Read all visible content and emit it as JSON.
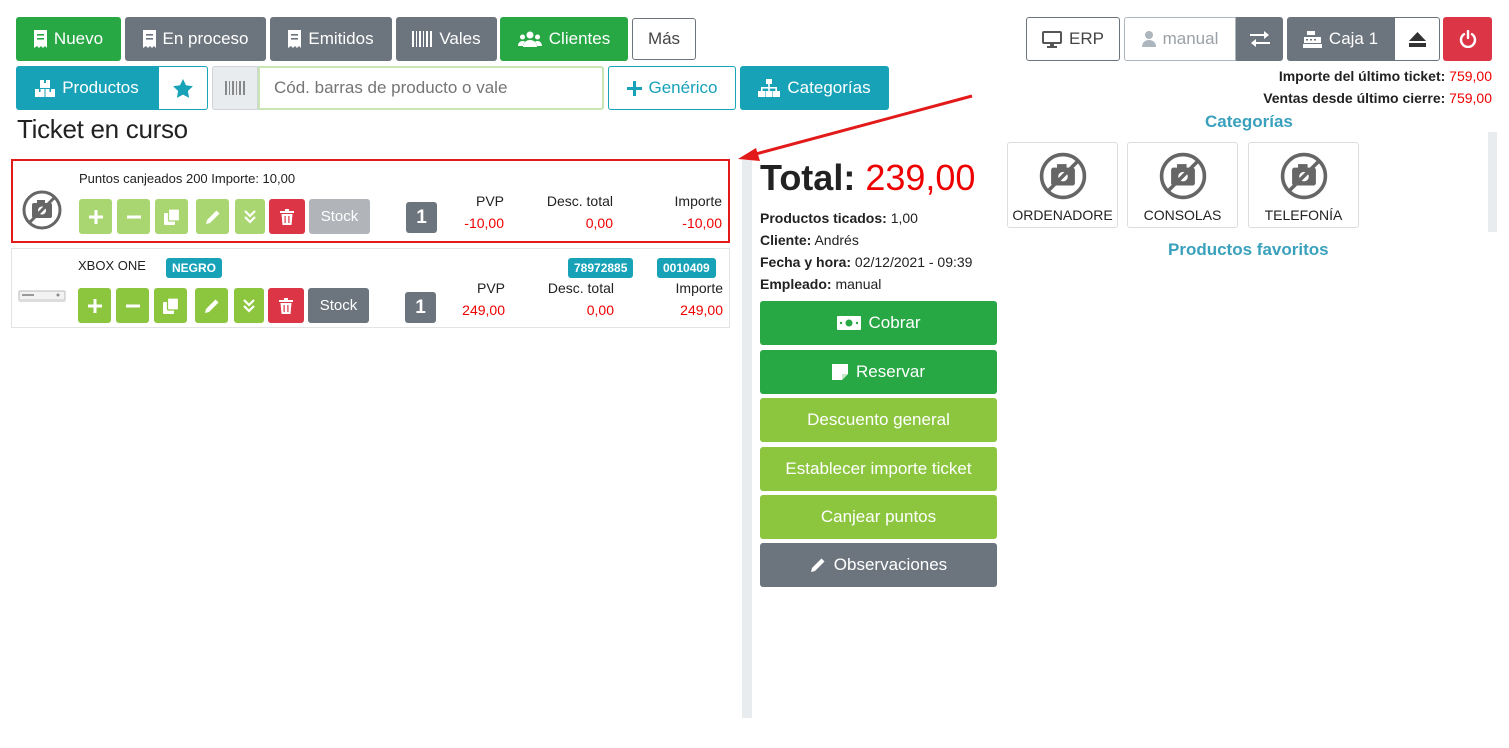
{
  "toolbar": {
    "nuevo": "Nuevo",
    "en_proceso": "En proceso",
    "emitidos": "Emitidos",
    "vales": "Vales",
    "clientes": "Clientes",
    "mas": "Más",
    "erp": "ERP",
    "user": "manual",
    "caja": "Caja 1"
  },
  "subtoolbar": {
    "productos": "Productos",
    "barcode_placeholder": "Cód. barras de producto o vale",
    "generico": "Genérico",
    "categorias": "Categorías"
  },
  "ticket": {
    "title": "Ticket en curso",
    "lines": [
      {
        "name": "Puntos canjeados 200 Importe: 10,00",
        "qty": "1",
        "pvp_label": "PVP",
        "pvp": "-10,00",
        "desc_label": "Desc. total",
        "desc": "0,00",
        "importe_label": "Importe",
        "importe": "-10,00",
        "stock_label": "Stock"
      },
      {
        "name": "XBOX ONE",
        "variant": "NEGRO",
        "badges": [
          "78972885",
          "0010409"
        ],
        "qty": "1",
        "pvp_label": "PVP",
        "pvp": "249,00",
        "desc_label": "Desc. total",
        "desc": "0,00",
        "importe_label": "Importe",
        "importe": "249,00",
        "stock_label": "Stock"
      }
    ]
  },
  "summary": {
    "total_label": "Total:",
    "total_value": "239,00",
    "productos_label": "Productos ticados:",
    "productos_value": "1,00",
    "cliente_label": "Cliente:",
    "cliente_value": "Andrés",
    "fecha_label": "Fecha y hora:",
    "fecha_value": "02/12/2021 - 09:39",
    "empleado_label": "Empleado:",
    "empleado_value": "manual"
  },
  "actions": {
    "cobrar": "Cobrar",
    "reservar": "Reservar",
    "descuento": "Descuento general",
    "establecer": "Establecer importe ticket",
    "canjear": "Canjear puntos",
    "observaciones": "Observaciones"
  },
  "right_panel": {
    "ultimo_ticket_label": "Importe del último ticket:",
    "ultimo_ticket_value": "759,00",
    "ventas_label": "Ventas desde último cierre:",
    "ventas_value": "759,00",
    "categorias_title": "Categorías",
    "categories": [
      "ORDENADORE",
      "CONSOLAS",
      "TELEFONÍA"
    ],
    "favoritos_title": "Productos favoritos"
  },
  "colors": {
    "green": "#28a745",
    "light_green": "#8cc63f",
    "teal": "#17a2b8",
    "gray": "#6c757d",
    "red": "#dc3545",
    "highlight": "#e21a1a"
  }
}
